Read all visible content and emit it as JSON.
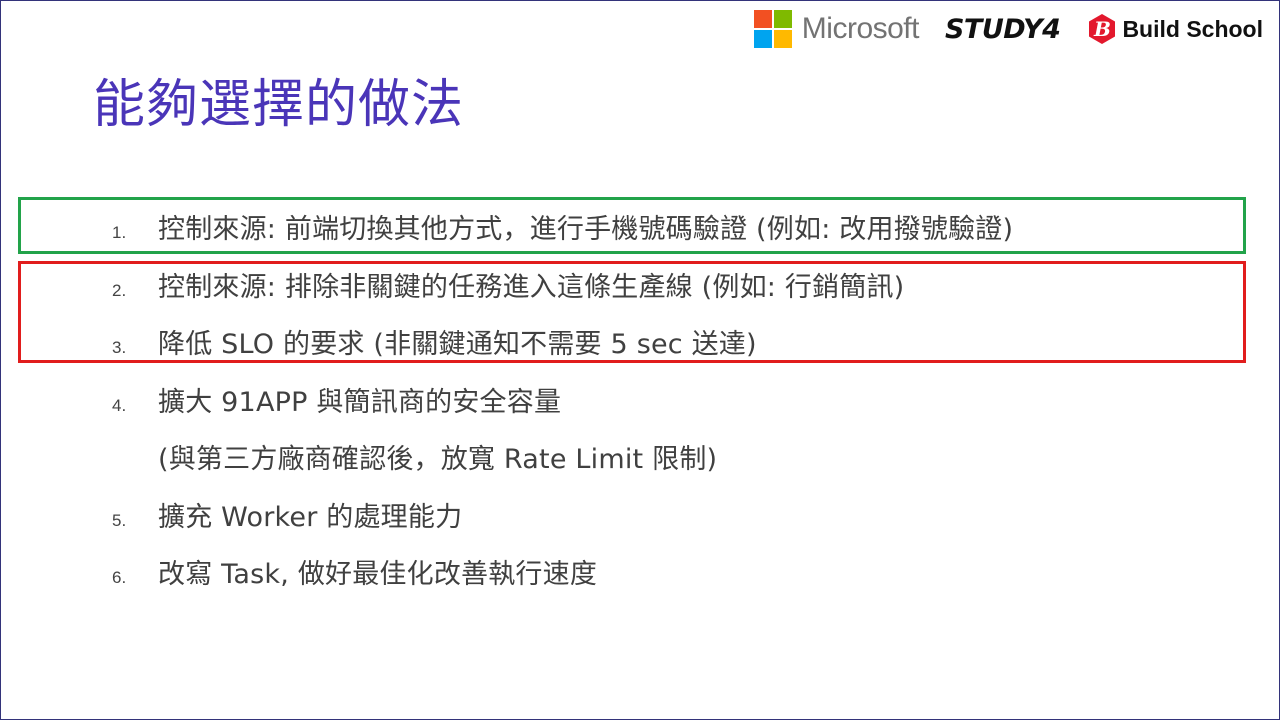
{
  "logos": {
    "microsoft": {
      "text": "Microsoft",
      "colors": [
        "#f25022",
        "#7fba00",
        "#00a4ef",
        "#ffb900"
      ]
    },
    "study4": "STUDY4",
    "buildschool": {
      "badge": "B",
      "text": "Build School",
      "color": "#e3182d"
    }
  },
  "slide": {
    "title": "能夠選擇的做法",
    "items": [
      {
        "number": "1.",
        "text": "控制來源: 前端切換其他方式，進行手機號碼驗證 (例如: 改用撥號驗證)"
      },
      {
        "number": "2.",
        "text": "控制來源: 排除非關鍵的任務進入這條生產線 (例如: 行銷簡訊)"
      },
      {
        "number": "3.",
        "text": "降低 SLO 的要求 (非關鍵通知不需要 5 sec 送達)"
      },
      {
        "number": "4.",
        "text": "擴大 91APP 與簡訊商的安全容量"
      },
      {
        "number": "",
        "text": "(與第三方廠商確認後，放寬 Rate Limit 限制)"
      },
      {
        "number": "5.",
        "text": "擴充 Worker 的處理能力"
      },
      {
        "number": "6.",
        "text": "改寫 Task, 做好最佳化改善執行速度"
      }
    ]
  },
  "colors": {
    "title": "#4a35b8",
    "body_text": "#404040",
    "highlight_green": "#22a34a",
    "highlight_red": "#e11d1d",
    "frame": "#33337a"
  }
}
